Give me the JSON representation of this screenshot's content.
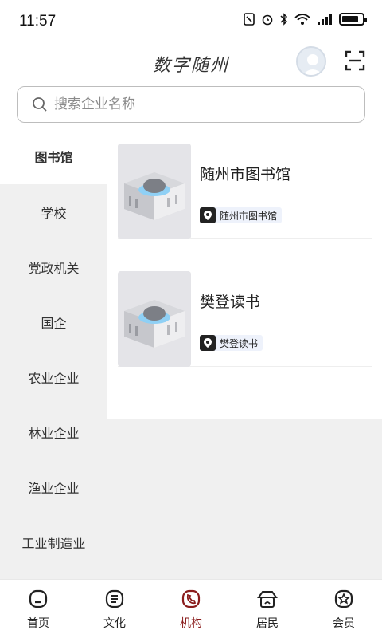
{
  "status_bar": {
    "time": "11:57",
    "battery_level": 0.85
  },
  "header": {
    "title": "数字随州",
    "search_placeholder": "搜索企业名称"
  },
  "sidebar": {
    "items": [
      {
        "label": "图书馆",
        "active": true
      },
      {
        "label": "学校",
        "active": false
      },
      {
        "label": "党政机关",
        "active": false
      },
      {
        "label": "国企",
        "active": false
      },
      {
        "label": "农业企业",
        "active": false
      },
      {
        "label": "林业企业",
        "active": false
      },
      {
        "label": "渔业企业",
        "active": false
      },
      {
        "label": "工业制造业",
        "active": false
      }
    ]
  },
  "list": [
    {
      "title": "随州市图书馆",
      "tag": "随州市图书馆"
    },
    {
      "title": "樊登读书",
      "tag": "樊登读书"
    }
  ],
  "bottom_nav": {
    "items": [
      {
        "label": "首页",
        "icon": "home-icon"
      },
      {
        "label": "文化",
        "icon": "culture-icon"
      },
      {
        "label": "机构",
        "icon": "institution-icon",
        "active": true
      },
      {
        "label": "居民",
        "icon": "resident-icon"
      },
      {
        "label": "会员",
        "icon": "member-icon"
      }
    ]
  },
  "colors": {
    "accent": "#8a1c1c",
    "tag_bg": "#eef2fb"
  }
}
